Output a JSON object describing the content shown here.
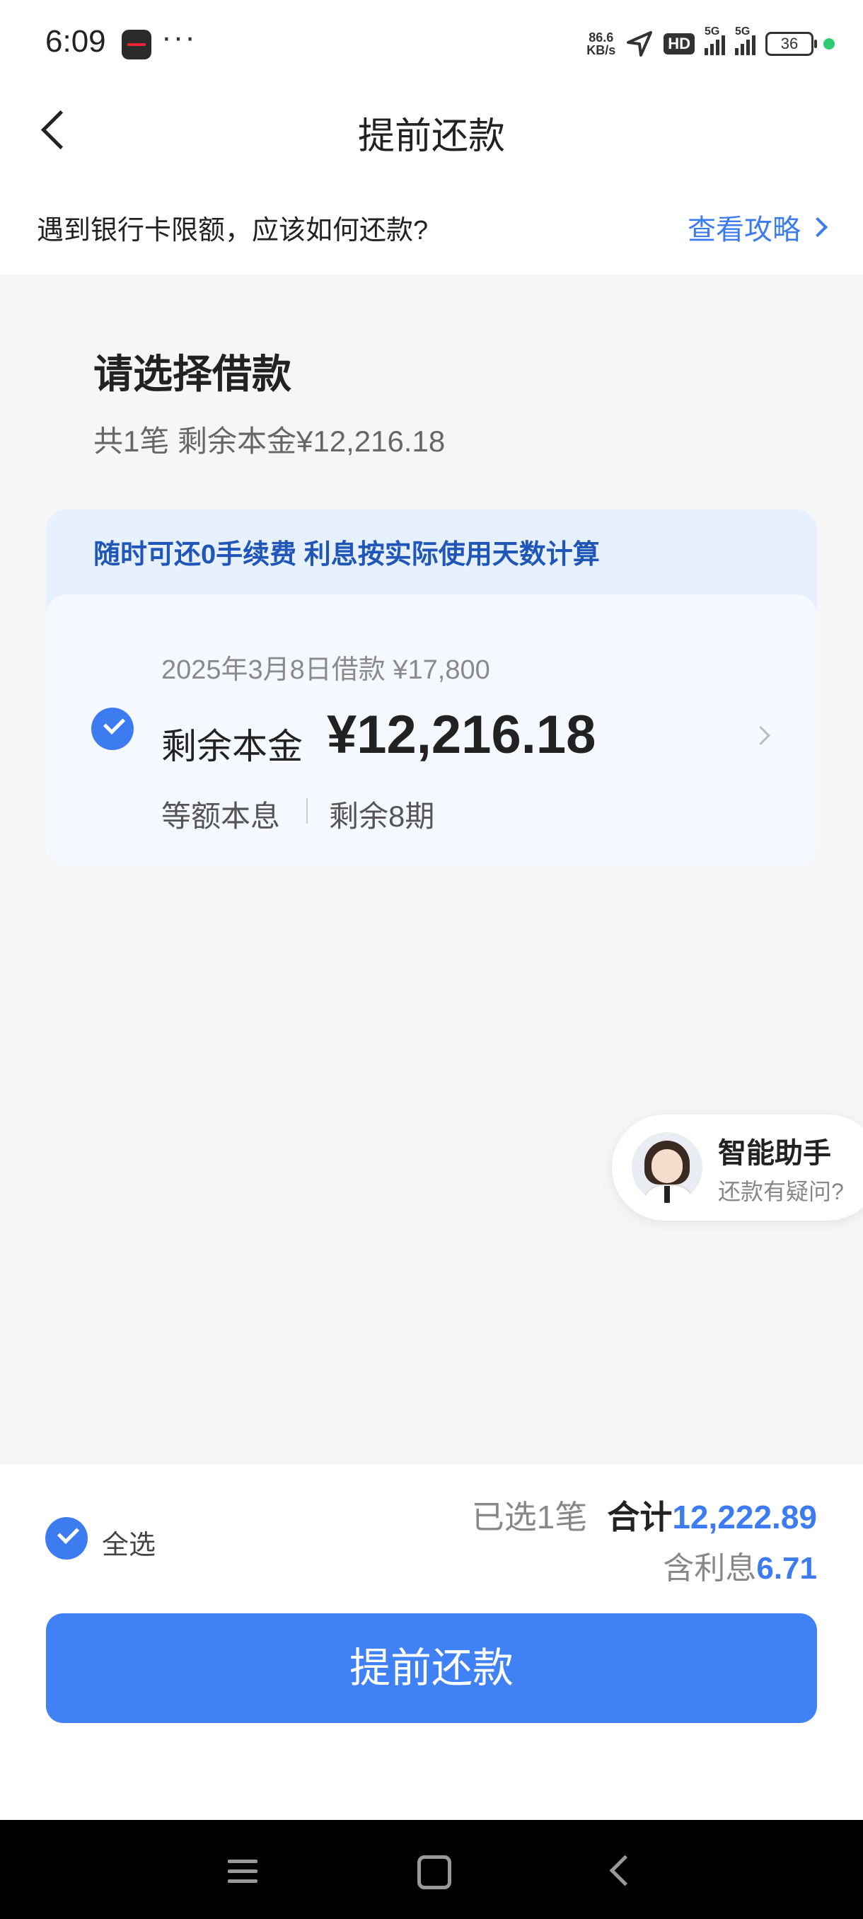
{
  "status_bar": {
    "time": "6:09",
    "dots": "···",
    "net_speed_value": "86.6",
    "net_speed_unit": "KB/s",
    "hd_label": "HD",
    "network_1": "5G",
    "network_2": "5G",
    "battery": "36",
    "battery_dot_color": "#2ecc71"
  },
  "header": {
    "title": "提前还款"
  },
  "tip": {
    "text": "遇到银行卡限额，应该如何还款?",
    "link_label": "查看攻略"
  },
  "section": {
    "title": "请选择借款",
    "subtitle": "共1笔 剩余本金¥12,216.18"
  },
  "loan_card": {
    "banner": "随时可还0手续费 利息按实际使用天数计算",
    "date_line": "2025年3月8日借款 ¥17,800",
    "remaining_label": "剩余本金",
    "remaining_amount": "¥12,216.18",
    "repay_type": "等额本息",
    "remaining_periods": "剩余8期",
    "checked": true
  },
  "assistant": {
    "title": "智能助手",
    "subtitle": "还款有疑问?"
  },
  "footer": {
    "select_all_label": "全选",
    "selected_text": "已选1笔",
    "total_label": "合计",
    "total_value": "12,222.89",
    "interest_label": "含利息",
    "interest_value": "6.71",
    "button_label": "提前还款"
  },
  "colors": {
    "accent": "#4081f5",
    "link": "#3d7bf0",
    "banner_text": "#1f56b8"
  }
}
